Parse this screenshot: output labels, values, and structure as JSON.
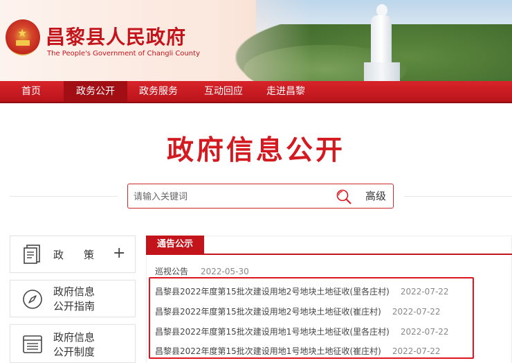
{
  "header": {
    "title": "昌黎县人民政府",
    "subtitle": "The People's Government of Changli County"
  },
  "nav": {
    "items": [
      {
        "label": "首页"
      },
      {
        "label": "政务公开"
      },
      {
        "label": "政务服务"
      },
      {
        "label": "互动回应"
      },
      {
        "label": "走进昌黎"
      }
    ],
    "active": "政务公开"
  },
  "main": {
    "title": "政府信息公开",
    "search": {
      "placeholder": "请输入关键词",
      "advanced_label": "高级"
    }
  },
  "sidebar": {
    "items": [
      {
        "line1": "政",
        "line2": "策",
        "icon": "document-icon",
        "action": "+"
      },
      {
        "line1": "政府信息",
        "line2": "公开指南",
        "icon": "compass-icon"
      },
      {
        "line1": "政府信息",
        "line2": "公开制度",
        "icon": "list-icon"
      }
    ]
  },
  "notices": {
    "tab_label": "通告公示",
    "items": [
      {
        "title": "巡视公告",
        "date": "2022-05-30"
      },
      {
        "title": "昌黎县2022年度第15批次建设用地2号地块土地征收(里各庄村)",
        "date": "2022-07-22"
      },
      {
        "title": "昌黎县2022年度第15批次建设用地2号地块土地征收(崔庄村)",
        "date": "2022-07-22"
      },
      {
        "title": "昌黎县2022年度第15批次建设用地1号地块土地征收(里各庄村)",
        "date": "2022-07-22"
      },
      {
        "title": "昌黎县2022年度第15批次建设用地1号地块土地征收(崔庄村)",
        "date": "2022-07-22"
      }
    ]
  },
  "colors": {
    "brand_red": "#c4141b",
    "nav_red": "#d8242a",
    "highlight": "#e0141b"
  }
}
